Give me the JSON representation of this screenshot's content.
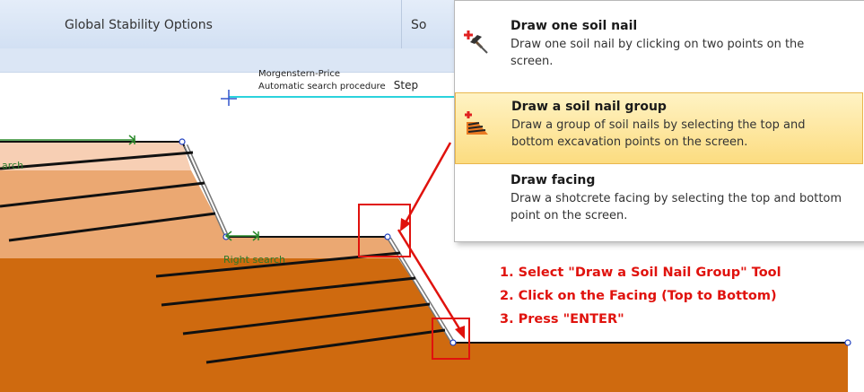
{
  "tabs": [
    {
      "label": "Global Stability Options"
    },
    {
      "label": "So"
    },
    {
      "label": ""
    },
    {
      "label": ""
    }
  ],
  "canvas": {
    "method_line1": "Morgenstern-Price",
    "method_line2": "Automatic search procedure",
    "method_step": "Step",
    "left_search_label": "arch",
    "right_search_label": "Right search"
  },
  "menu": {
    "items": [
      {
        "title": "Draw one soil nail",
        "description": "Draw one soil nail by clicking on two points on the screen.",
        "icon": "hammer-add-icon"
      },
      {
        "title": "Draw a soil nail group",
        "description": "Draw a group of soil nails by selecting the top and bottom excavation points on the screen.",
        "icon": "nail-group-add-icon"
      },
      {
        "title": "Draw facing",
        "description": "Draw a shotcrete facing by selecting the top and bottom point on the screen.",
        "icon": ""
      }
    ]
  },
  "instructions": [
    "1. Select \"Draw a Soil Nail Group\" Tool",
    "2. Click on the Facing (Top to Bottom)",
    "3. Press \"ENTER\""
  ],
  "colors": {
    "soil_dark": "#cf6a0f",
    "soil_mid": "#eba872",
    "soil_light": "#f7cfb4",
    "annotation_red": "#e0120d",
    "menu_highlight": "#fcdc80"
  }
}
